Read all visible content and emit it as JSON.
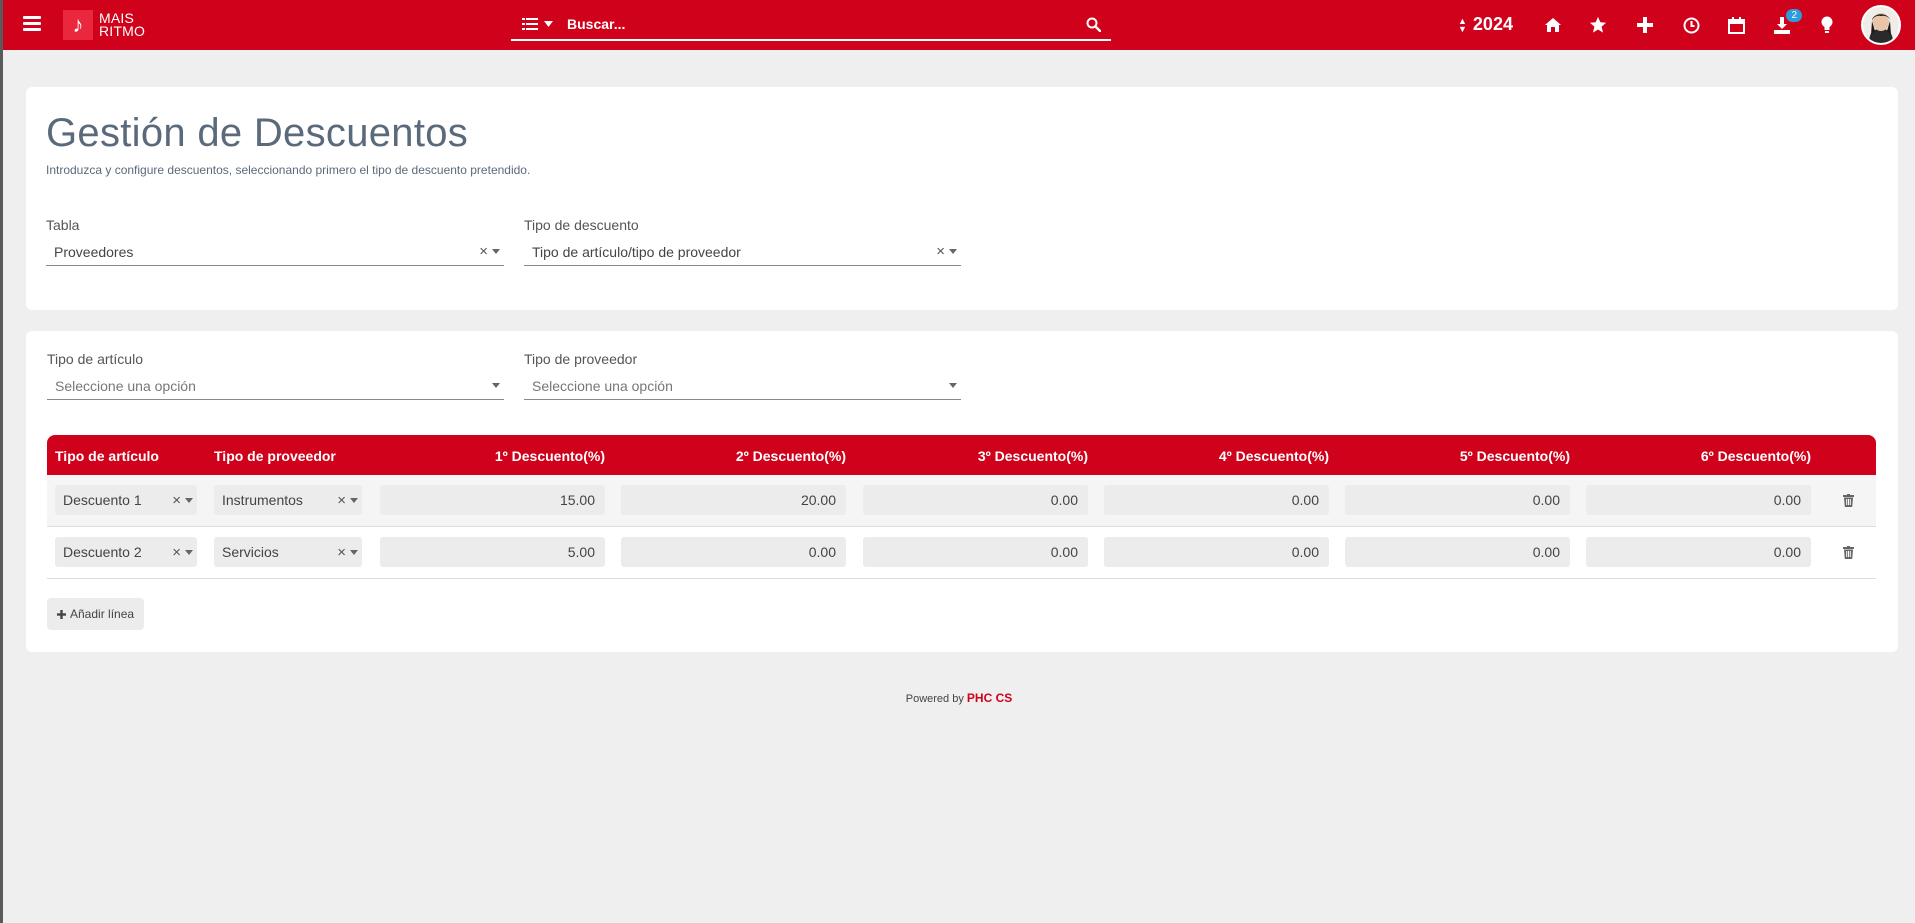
{
  "topbar": {
    "logo_line1": "MAIS",
    "logo_line2": "RITMO",
    "search_placeholder": "Buscar...",
    "year": "2024",
    "downloads_badge": "2",
    "icons": [
      "menu-icon",
      "list-icon",
      "search-icon",
      "home-icon",
      "star-icon",
      "plus-icon",
      "clock-icon",
      "calendar-icon",
      "download-icon",
      "lightbulb-icon"
    ]
  },
  "header": {
    "title": "Gestión de Descuentos",
    "subtitle": "Introduzca y configure descuentos, seleccionando primero el tipo de descuento pretendido.",
    "tabla_label": "Tabla",
    "tabla_value": "Proveedores",
    "tipo_descuento_label": "Tipo de descuento",
    "tipo_descuento_value": "Tipo de artículo/tipo de proveedor"
  },
  "filters": {
    "tipo_articulo_label": "Tipo de artículo",
    "tipo_articulo_placeholder": "Seleccione una opción",
    "tipo_proveedor_label": "Tipo de proveedor",
    "tipo_proveedor_placeholder": "Seleccione una opción"
  },
  "table": {
    "columns": [
      "Tipo de artículo",
      "Tipo de proveedor",
      "1º Descuento(%)",
      "2º Descuento(%)",
      "3º Descuento(%)",
      "4º Descuento(%)",
      "5º Descuento(%)",
      "6º Descuento(%)"
    ],
    "rows": [
      {
        "tipo_articulo": "Descuento 1",
        "tipo_proveedor": "Instrumentos",
        "d1": "15.00",
        "d2": "20.00",
        "d3": "0.00",
        "d4": "0.00",
        "d5": "0.00",
        "d6": "0.00"
      },
      {
        "tipo_articulo": "Descuento 2",
        "tipo_proveedor": "Servicios",
        "d1": "5.00",
        "d2": "0.00",
        "d3": "0.00",
        "d4": "0.00",
        "d5": "0.00",
        "d6": "0.00"
      }
    ],
    "add_line_label": "Añadir línea"
  },
  "footer": {
    "powered_by": "Powered by",
    "brand": "PHC CS"
  },
  "colors": {
    "brand": "#d0021b",
    "badge": "#2d9cdb"
  }
}
